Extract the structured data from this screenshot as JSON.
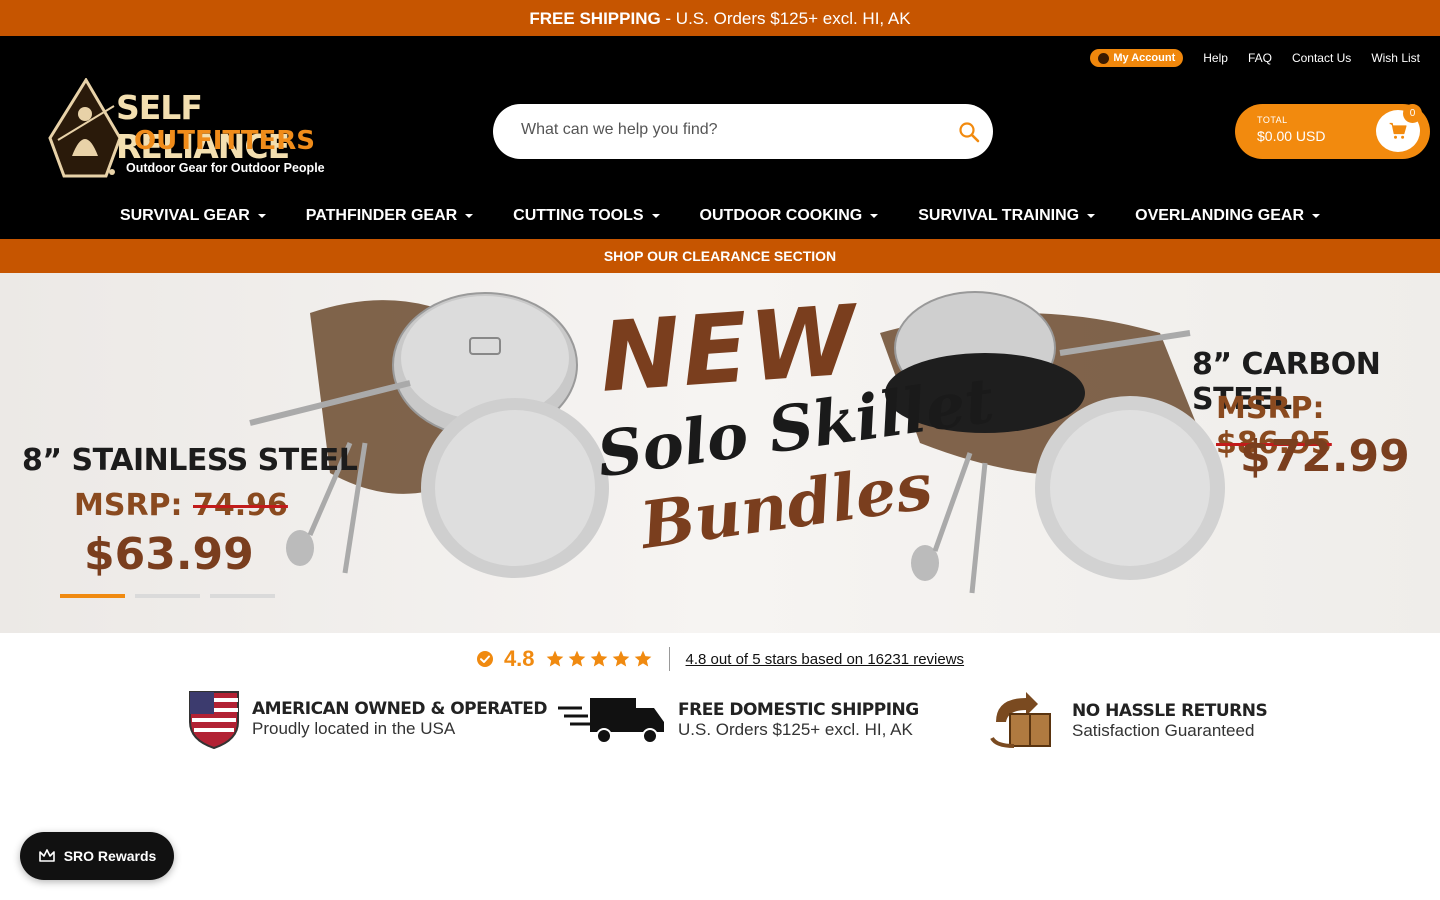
{
  "announcement": {
    "bold": "FREE SHIPPING",
    "rest": " - U.S. Orders $125+ excl. HI, AK"
  },
  "utility": {
    "account": "My Account",
    "help": "Help",
    "faq": "FAQ",
    "contact": "Contact Us",
    "wishlist": "Wish List"
  },
  "logo": {
    "line1": "SELF RELIANCE",
    "line2": "OUTFITTERS",
    "tagline": "Outdoor Gear for Outdoor People"
  },
  "search": {
    "placeholder": "What can we help you find?"
  },
  "cart": {
    "label": "TOTAL",
    "value": "$0.00 USD",
    "count": "0"
  },
  "nav": {
    "items": [
      "SURVIVAL GEAR",
      "PATHFINDER GEAR",
      "CUTTING TOOLS",
      "OUTDOOR COOKING",
      "SURVIVAL TRAINING",
      "OVERLANDING GEAR"
    ]
  },
  "clearance": "SHOP OUR CLEARANCE SECTION",
  "hero": {
    "left_title": "8” STAINLESS STEEL",
    "left_msrp_label": "MSRP:",
    "left_msrp": "74.96",
    "left_price": "$63.99",
    "headline1": "NEW",
    "headline2": "Solo Skillet",
    "headline3": "Bundles",
    "right_title": "8” CARBON STEEL",
    "right_msrp_label": "MSRP:",
    "right_msrp": "$86.95",
    "right_price": "$72.99",
    "active_slide": 1,
    "slide_count": 3
  },
  "rating": {
    "score": "4.8",
    "stars": 5,
    "text": "4.8 out of 5 stars based on 16231 reviews"
  },
  "badges": [
    {
      "title": "AMERICAN OWNED & OPERATED",
      "subtitle": "Proudly located in the USA"
    },
    {
      "title": "FREE DOMESTIC SHIPPING",
      "subtitle": "U.S. Orders $125+ excl. HI, AK"
    },
    {
      "title": "NO HASSLE RETURNS",
      "subtitle": "Satisfaction Guaranteed"
    }
  ],
  "rewards": {
    "label": "SRO Rewards"
  },
  "colors": {
    "accent": "#f28a0e",
    "brand_orange": "#c65500",
    "brown": "#7a3e1e"
  }
}
